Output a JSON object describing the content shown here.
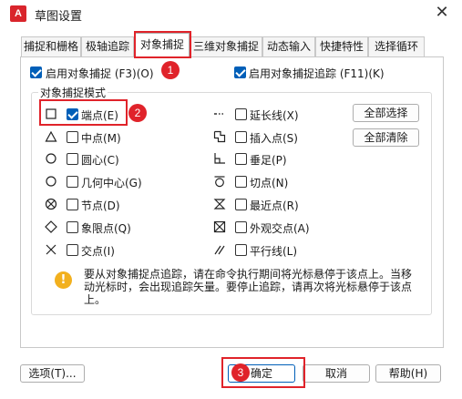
{
  "window": {
    "title": "草图设置",
    "app_icon": "A",
    "close": "✕"
  },
  "tabs": [
    {
      "label": "捕捉和栅格"
    },
    {
      "label": "极轴追踪"
    },
    {
      "label": "对象捕捉"
    },
    {
      "label": "三维对象捕捉"
    },
    {
      "label": "动态输入"
    },
    {
      "label": "快捷特性"
    },
    {
      "label": "选择循环"
    }
  ],
  "options": {
    "enable_snap": "启用对象捕捉 (F3)(O)",
    "enable_tracking": "启用对象捕捉追踪 (F11)(K)"
  },
  "group_title": "对象捕捉模式",
  "modes_left": [
    {
      "label": "端点(E)",
      "checked": true,
      "symbol": "square"
    },
    {
      "label": "中点(M)",
      "checked": false,
      "symbol": "triangle"
    },
    {
      "label": "圆心(C)",
      "checked": false,
      "symbol": "circle"
    },
    {
      "label": "几何中心(G)",
      "checked": false,
      "symbol": "circle"
    },
    {
      "label": "节点(D)",
      "checked": false,
      "symbol": "circle-x"
    },
    {
      "label": "象限点(Q)",
      "checked": false,
      "symbol": "diamond"
    },
    {
      "label": "交点(I)",
      "checked": false,
      "symbol": "x"
    }
  ],
  "modes_right": [
    {
      "label": "延长线(X)",
      "checked": false,
      "symbol": "extension"
    },
    {
      "label": "插入点(S)",
      "checked": false,
      "symbol": "insertion"
    },
    {
      "label": "垂足(P)",
      "checked": false,
      "symbol": "perpendicular"
    },
    {
      "label": "切点(N)",
      "checked": false,
      "symbol": "tangent"
    },
    {
      "label": "最近点(R)",
      "checked": false,
      "symbol": "hourglass"
    },
    {
      "label": "外观交点(A)",
      "checked": false,
      "symbol": "box-x"
    },
    {
      "label": "平行线(L)",
      "checked": false,
      "symbol": "parallel"
    }
  ],
  "buttons": {
    "select_all": "全部选择",
    "clear_all": "全部清除",
    "options": "选项(T)...",
    "ok": "确定",
    "cancel": "取消",
    "help": "帮助(H)"
  },
  "info": "要从对象捕捉点追踪，请在命令执行期间将光标悬停于该点上。当移动光标时，会出现追踪矢量。要停止追踪，请再次将光标悬停于该点上。",
  "annotations": [
    {
      "label": "1"
    },
    {
      "label": "2"
    },
    {
      "label": "3"
    }
  ],
  "colors": {
    "accent": "#005fb8",
    "annotation": "#e0232a",
    "warning": "#f2b01e"
  }
}
